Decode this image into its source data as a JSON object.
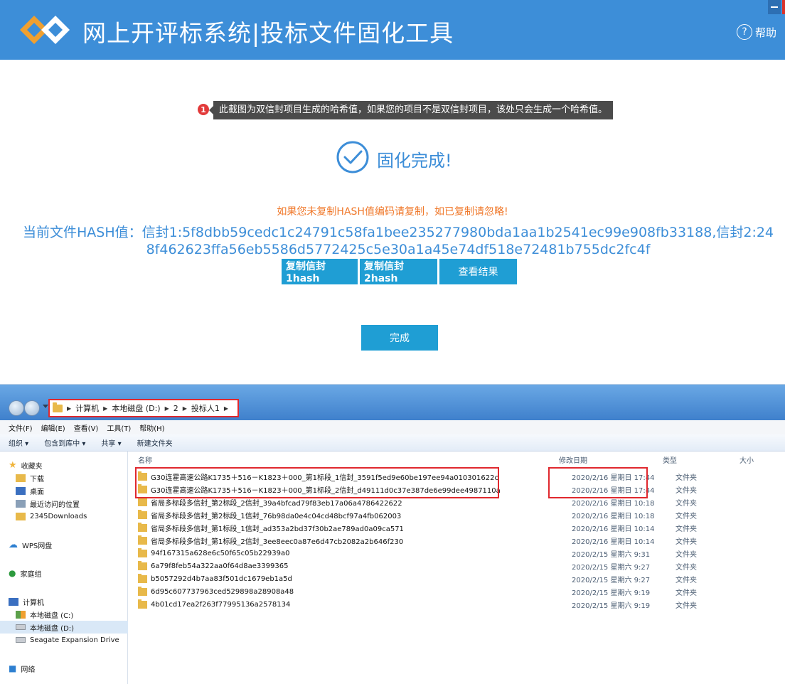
{
  "app": {
    "title": "网上开评标系统|投标文件固化工具",
    "help_label": "帮助",
    "help_icon": "?"
  },
  "note": {
    "badge": "1",
    "text": "此截图为双信封项目生成的哈希值，如果您的项目不是双信封项目，该处只会生成一个哈希值。"
  },
  "result": {
    "success_text": "固化完成!",
    "copy_hint": "如果您未复制HASH值编码请复制，如已复制请忽略!",
    "hash_text": "当前文件HASH值：信封1:5f8dbb59cedc1c24791c58fa1bee235277980bda1aa1b2541ec99e908fb33188,信封2:248f462623ffa56eb5586d5772425c5e30a1a45e74df518e72481b755dc2fc4f",
    "buttons": [
      "复制信封1hash",
      "复制信封2hash",
      "查看结果"
    ],
    "done_label": "完成"
  },
  "explorer": {
    "breadcrumb": [
      "计算机",
      "本地磁盘 (D:)",
      "2",
      "投标人1"
    ],
    "menu": [
      "文件(F)",
      "编辑(E)",
      "查看(V)",
      "工具(T)",
      "帮助(H)"
    ],
    "toolbar": [
      "组织 ▾",
      "包含到库中 ▾",
      "共享 ▾",
      "新建文件夹"
    ],
    "nav": {
      "favorites": "收藏夹",
      "downloads": "下载",
      "desktop": "桌面",
      "recent": "最近访问的位置",
      "folder2345": "2345Downloads",
      "wps": "WPS网盘",
      "homegroup": "家庭组",
      "computer": "计算机",
      "drive_c": "本地磁盘 (C:)",
      "drive_d": "本地磁盘 (D:)",
      "seagate": "Seagate Expansion Drive",
      "network": "网络"
    },
    "columns": {
      "name": "名称",
      "date": "修改日期",
      "type": "类型",
      "size": "大小"
    },
    "files": [
      {
        "name": "G30连霍高速公路K1735＋516－K1823＋000_第1标段_1信封_3591f5ed9e60be197ee94a010301622c",
        "date": "2020/2/16 星期日 17:44",
        "type": "文件夹"
      },
      {
        "name": "G30连霍高速公路K1735＋516－K1823＋000_第1标段_2信封_d49111d0c37e387de6e99dee4987110a",
        "date": "2020/2/16 星期日 17:44",
        "type": "文件夹"
      },
      {
        "name": "省局多标段多信封_第2标段_2信封_39a4bfcad79f83eb17a06a4786422622",
        "date": "2020/2/16 星期日 10:18",
        "type": "文件夹"
      },
      {
        "name": "省局多标段多信封_第2标段_1信封_76b98da0e4c04cd48bcf97a4fb062003",
        "date": "2020/2/16 星期日 10:18",
        "type": "文件夹"
      },
      {
        "name": "省局多标段多信封_第1标段_1信封_ad353a2bd37f30b2ae789ad0a09ca571",
        "date": "2020/2/16 星期日 10:14",
        "type": "文件夹"
      },
      {
        "name": "省局多标段多信封_第1标段_2信封_3ee8eec0a87e6d47cb2082a2b646f230",
        "date": "2020/2/16 星期日 10:14",
        "type": "文件夹"
      },
      {
        "name": "94f167315a628e6c50f65c05b22939a0",
        "date": "2020/2/15 星期六 9:31",
        "type": "文件夹"
      },
      {
        "name": "6a79f8feb54a322aa0f64d8ae3399365",
        "date": "2020/2/15 星期六 9:27",
        "type": "文件夹"
      },
      {
        "name": "b5057292d4b7aa83f501dc1679eb1a5d",
        "date": "2020/2/15 星期六 9:27",
        "type": "文件夹"
      },
      {
        "name": "6d95c607737963ced529898a28908a48",
        "date": "2020/2/15 星期六 9:19",
        "type": "文件夹"
      },
      {
        "name": "4b01cd17ea2f263f77995136a2578134",
        "date": "2020/2/15 星期六 9:19",
        "type": "文件夹"
      }
    ]
  },
  "colors": {
    "header_blue": "#3d8ed8",
    "button_blue": "#1f9ed4",
    "hint_orange": "#f0782a",
    "highlight_red": "#e0282e"
  }
}
